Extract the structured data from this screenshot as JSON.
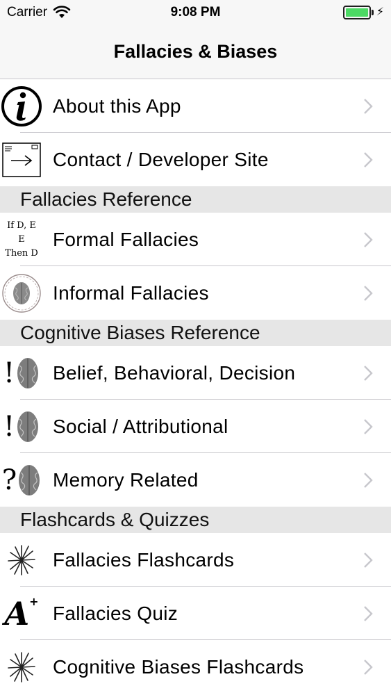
{
  "status_bar": {
    "carrier": "Carrier",
    "time": "9:08 PM",
    "battery_color": "#4cd964"
  },
  "nav": {
    "title": "Fallacies & Biases"
  },
  "rows_top": [
    {
      "label": "About this App",
      "icon": "info-icon"
    },
    {
      "label": "Contact / Developer Site",
      "icon": "contact-arrow-icon"
    }
  ],
  "sections": {
    "fallacies": {
      "header": "Fallacies Reference",
      "rows": [
        {
          "label": "Formal Fallacies",
          "icon": "logic-text-icon",
          "icon_text": [
            "If D, E",
            "E",
            "Then D"
          ]
        },
        {
          "label": "Informal Fallacies",
          "icon": "brain-wreath-icon"
        }
      ]
    },
    "biases": {
      "header": "Cognitive Biases Reference",
      "rows": [
        {
          "label": "Belief, Behavioral, Decision",
          "icon": "exclaim-brain-icon",
          "icon_mark": "!"
        },
        {
          "label": "Social / Attributional",
          "icon": "exclaim-brain-icon",
          "icon_mark": "!"
        },
        {
          "label": "Memory Related",
          "icon": "question-brain-icon",
          "icon_mark": "?"
        }
      ]
    },
    "flashcards": {
      "header": "Flashcards & Quizzes",
      "rows": [
        {
          "label": "Fallacies Flashcards",
          "icon": "starburst-icon"
        },
        {
          "label": "Fallacies Quiz",
          "icon": "a-plus-icon",
          "icon_mark": "A",
          "icon_sup": "+"
        },
        {
          "label": "Cognitive Biases Flashcards",
          "icon": "starburst-icon"
        }
      ]
    }
  }
}
